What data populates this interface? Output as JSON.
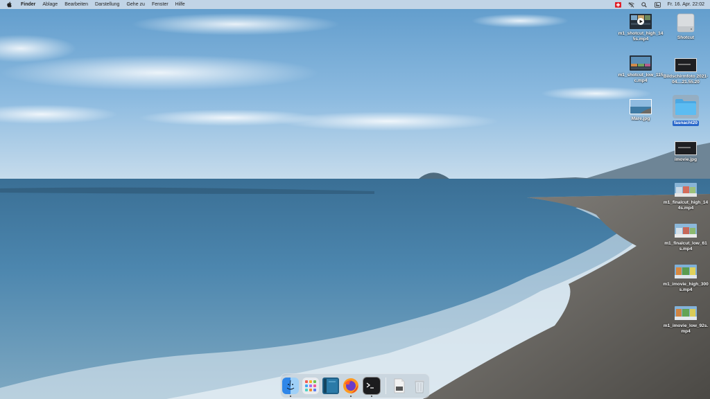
{
  "menubar": {
    "app_name": "Finder",
    "menus": [
      "Ablage",
      "Bearbeiten",
      "Darstellung",
      "Gehe zu",
      "Fenster",
      "Hilfe"
    ],
    "clock": "Fr. 16. Apr.  22:02",
    "status_icons": [
      "swiss-flag-icon",
      "wifi-off-icon",
      "search-icon",
      "control-center-icon"
    ]
  },
  "desktop": {
    "icons": [
      {
        "label": "m1_shotcut_high_145s.mp4",
        "kind": "video-thumbnail"
      },
      {
        "label": "Shotcut",
        "kind": "disk-image"
      },
      {
        "label": "m1_shotcut_low_115c.mp4",
        "kind": "video-thumbnail"
      },
      {
        "label": "Bildschirmfoto 2021-04....21.55.20",
        "kind": "screenshot"
      },
      {
        "label": "Mare.jpg",
        "kind": "photo"
      },
      {
        "label": "fasnacht20",
        "kind": "folder",
        "selected": true
      },
      {
        "label": "imovie.jpg",
        "kind": "screenshot"
      },
      {
        "label": "m1_finalcut_high_144s.mp4",
        "kind": "video-thumbnail"
      },
      {
        "label": "m1_finalcut_low_61s.mp4",
        "kind": "video-thumbnail"
      },
      {
        "label": "m1_imovie_high_300s.mp4",
        "kind": "video-thumbnail"
      },
      {
        "label": "m1_imovie_low_92s.mp4",
        "kind": "video-thumbnail"
      }
    ]
  },
  "dock": {
    "apps": [
      {
        "name": "finder-icon",
        "running": true
      },
      {
        "name": "launchpad-icon",
        "running": false
      },
      {
        "name": "book-app-icon",
        "running": false
      },
      {
        "name": "firefox-icon",
        "running": true
      },
      {
        "name": "terminal-icon",
        "running": true
      },
      {
        "name": "document-icon",
        "running": false
      },
      {
        "name": "trash-icon",
        "running": false
      }
    ]
  },
  "colors": {
    "selection": "#2866c9",
    "sky": "#7fb2d9",
    "sea": "#3f7ba4",
    "folder": "#59b6ec"
  }
}
